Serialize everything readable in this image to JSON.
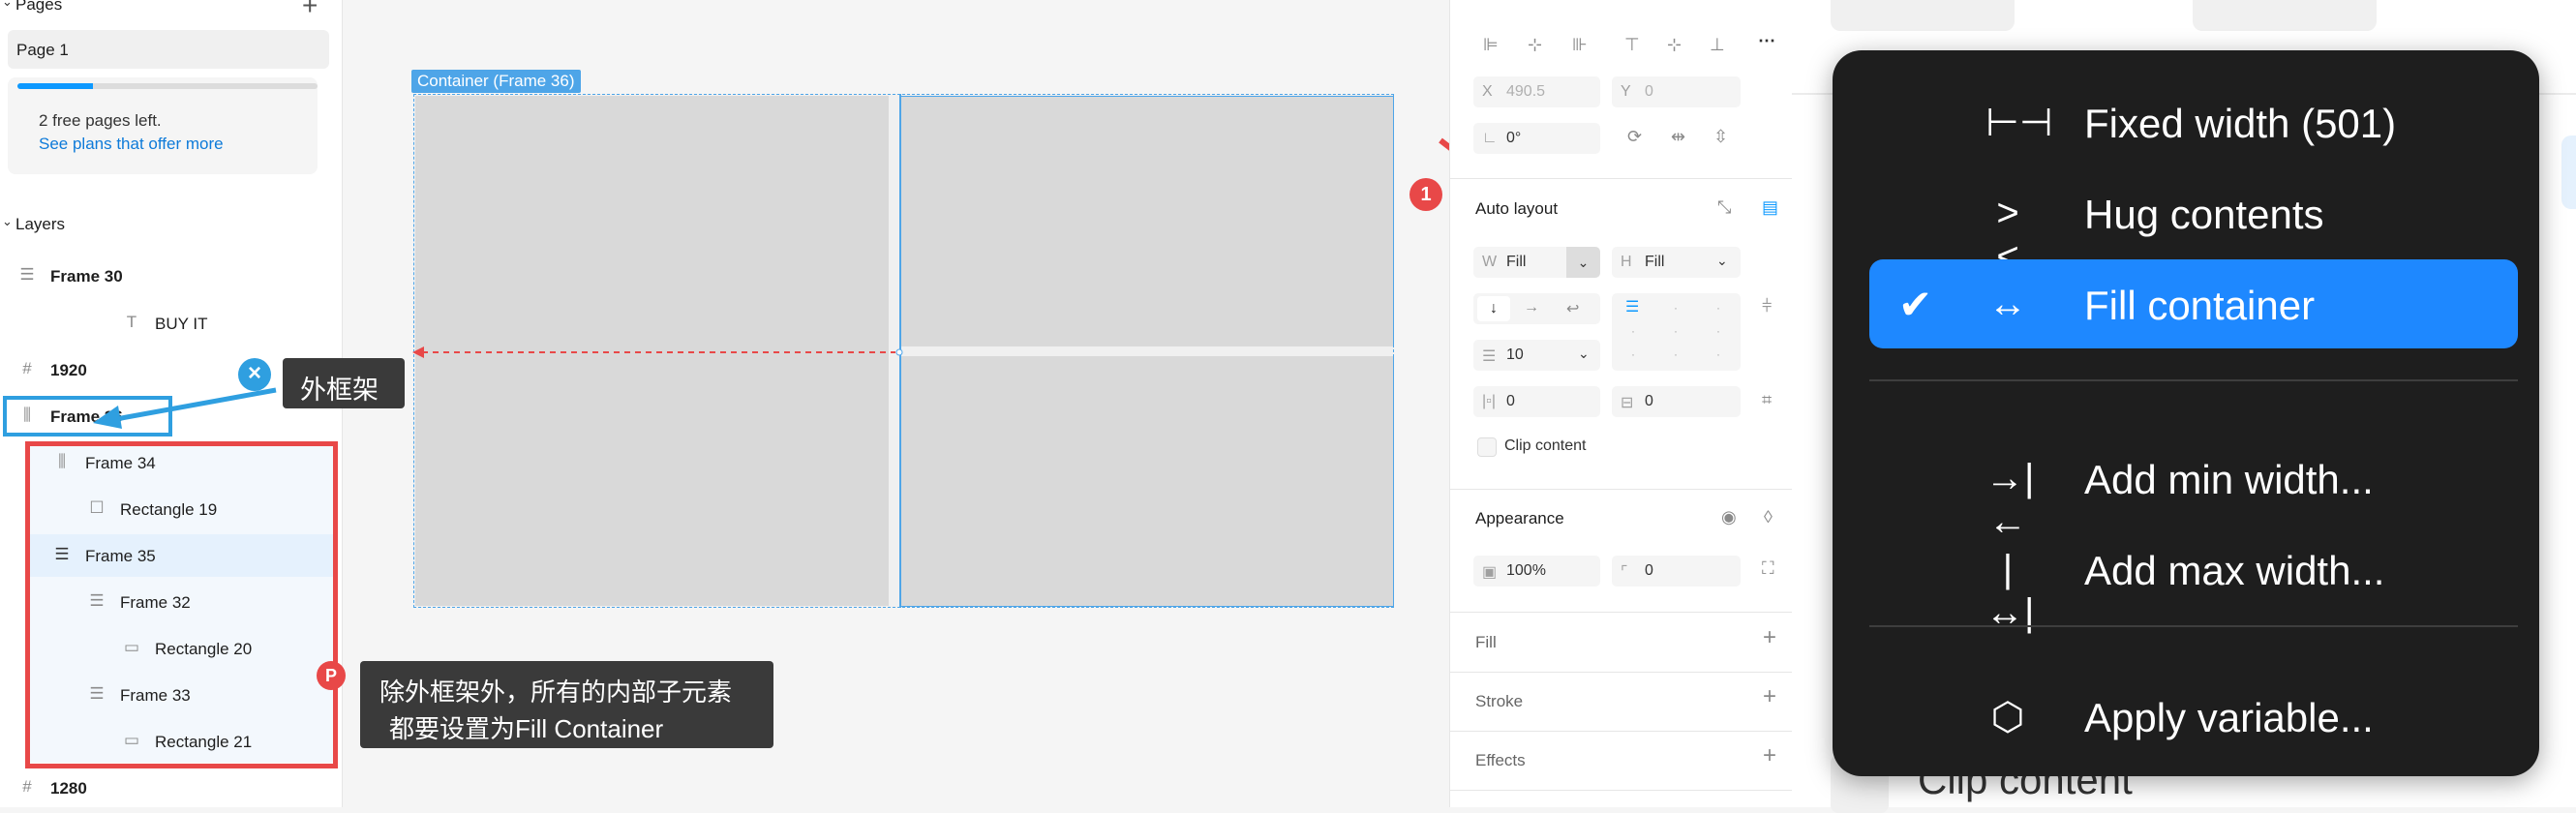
{
  "left_panel": {
    "pages_title": "Pages",
    "add_icon": "plus-icon",
    "page_name": "Page 1",
    "progress_percent": 25,
    "free_pages_text": "2 free pages left.",
    "plans_link": "See plans that offer more",
    "layers_title": "Layers",
    "layers": [
      {
        "name": "Frame 30",
        "icon": "auto-layout-vertical-icon"
      },
      {
        "name": "BUY IT",
        "icon": "text-icon"
      },
      {
        "name": "1920",
        "icon": "frame-hash-icon"
      },
      {
        "name": "Frame 36",
        "icon": "auto-layout-horizontal-icon"
      },
      {
        "name": "Frame 34",
        "icon": "auto-layout-horizontal-icon"
      },
      {
        "name": "Rectangle 19",
        "icon": "rectangle-icon"
      },
      {
        "name": "Frame 35",
        "icon": "auto-layout-vertical-icon"
      },
      {
        "name": "Frame 32",
        "icon": "auto-layout-vertical-icon"
      },
      {
        "name": "Rectangle 20",
        "icon": "rectangle-icon"
      },
      {
        "name": "Frame 33",
        "icon": "auto-layout-vertical-icon"
      },
      {
        "name": "Rectangle 21",
        "icon": "rectangle-icon"
      },
      {
        "name": "1280",
        "icon": "frame-hash-icon"
      }
    ]
  },
  "canvas": {
    "frame_label": "Container (Frame 36)"
  },
  "annotations": {
    "outer_frame_label": "外框架",
    "inner_note_line1": "除外框架外，所有的内部子元素",
    "inner_note_line2": "都要设置为Fill Container",
    "step_number": "1",
    "close_badge": "×",
    "flag_badge": "P",
    "accent_blue": "#2f9fe0",
    "accent_red": "#e84848"
  },
  "props": {
    "x_label": "X",
    "x_value": "490.5",
    "y_label": "Y",
    "y_value": "0",
    "rotation_value": "0°",
    "auto_layout_title": "Auto layout",
    "w_label": "W",
    "w_value": "Fill",
    "h_label": "H",
    "h_value": "Fill",
    "gap_value": "10",
    "padding_h": "0",
    "padding_v": "0",
    "clip_content": "Clip content",
    "appearance_title": "Appearance",
    "opacity_value": "100%",
    "radius_value": "0",
    "fill_title": "Fill",
    "stroke_title": "Stroke",
    "effects_title": "Effects"
  },
  "size_menu": {
    "items": [
      {
        "icon": "fixed-width-icon",
        "label": "Fixed width (501)",
        "selected": false
      },
      {
        "icon": "hug-contents-icon",
        "label": "Hug contents",
        "selected": false
      },
      {
        "icon": "fill-container-icon",
        "label": "Fill container",
        "selected": true
      },
      {
        "icon": "min-width-icon",
        "label": "Add min width...",
        "selected": false
      },
      {
        "icon": "max-width-icon",
        "label": "Add max width...",
        "selected": false
      },
      {
        "icon": "variable-hexagon-icon",
        "label": "Apply variable...",
        "selected": false
      }
    ],
    "bottom_peek": "Clip content",
    "accent": "#1e88ff"
  }
}
